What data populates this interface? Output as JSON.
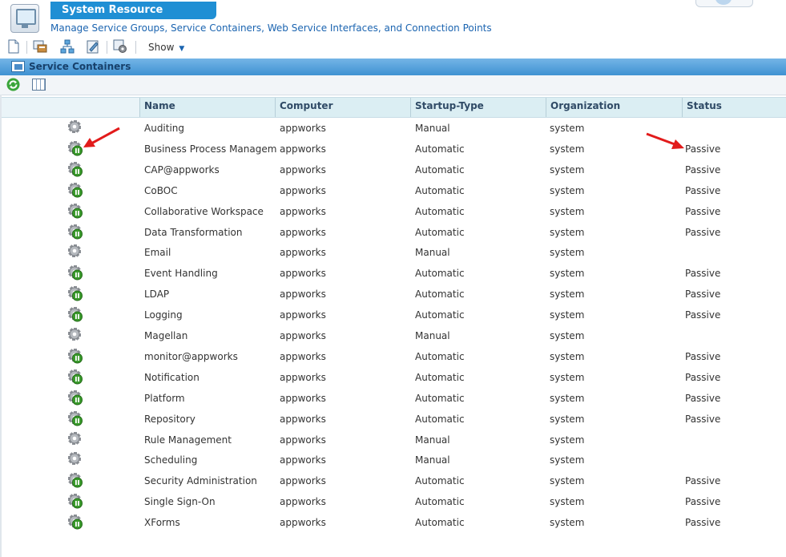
{
  "header": {
    "title": "System Resource Manager",
    "subtitle": "Manage Service Groups, Service Containers, Web Service Interfaces, and Connection Points"
  },
  "toolbar": {
    "icons": [
      "new-document-icon",
      "service-group-icon",
      "hierarchy-icon",
      "edit-icon",
      "configure-icon"
    ],
    "show_label": "Show"
  },
  "panel": {
    "title": "Service Containers",
    "refresh_icon": "refresh-icon",
    "columns_icon": "columns-icon"
  },
  "table": {
    "columns": [
      "Name",
      "Computer",
      "Startup-Type",
      "Organization",
      "Status"
    ],
    "rows": [
      {
        "name": "Auditing",
        "computer": "appworks",
        "startup": "Manual",
        "org": "system",
        "status": "",
        "icon": "gear-stopped-icon"
      },
      {
        "name": "Business Process Manageme",
        "computer": "appworks",
        "startup": "Automatic",
        "org": "system",
        "status": "Passive",
        "icon": "gear-running-icon"
      },
      {
        "name": "CAP@appworks",
        "computer": "appworks",
        "startup": "Automatic",
        "org": "system",
        "status": "Passive",
        "icon": "gear-running-icon"
      },
      {
        "name": "CoBOC",
        "computer": "appworks",
        "startup": "Automatic",
        "org": "system",
        "status": "Passive",
        "icon": "gear-running-icon"
      },
      {
        "name": "Collaborative Workspace",
        "computer": "appworks",
        "startup": "Automatic",
        "org": "system",
        "status": "Passive",
        "icon": "gear-running-icon"
      },
      {
        "name": "Data Transformation",
        "computer": "appworks",
        "startup": "Automatic",
        "org": "system",
        "status": "Passive",
        "icon": "gear-running-icon"
      },
      {
        "name": "Email",
        "computer": "appworks",
        "startup": "Manual",
        "org": "system",
        "status": "",
        "icon": "gear-stopped-icon"
      },
      {
        "name": "Event Handling",
        "computer": "appworks",
        "startup": "Automatic",
        "org": "system",
        "status": "Passive",
        "icon": "gear-running-icon"
      },
      {
        "name": "LDAP",
        "computer": "appworks",
        "startup": "Automatic",
        "org": "system",
        "status": "Passive",
        "icon": "gear-running-icon"
      },
      {
        "name": "Logging",
        "computer": "appworks",
        "startup": "Automatic",
        "org": "system",
        "status": "Passive",
        "icon": "gear-running-icon"
      },
      {
        "name": "Magellan",
        "computer": "appworks",
        "startup": "Manual",
        "org": "system",
        "status": "",
        "icon": "gear-stopped-icon"
      },
      {
        "name": "monitor@appworks",
        "computer": "appworks",
        "startup": "Automatic",
        "org": "system",
        "status": "Passive",
        "icon": "gear-running-icon"
      },
      {
        "name": "Notification",
        "computer": "appworks",
        "startup": "Automatic",
        "org": "system",
        "status": "Passive",
        "icon": "gear-running-icon"
      },
      {
        "name": "Platform",
        "computer": "appworks",
        "startup": "Automatic",
        "org": "system",
        "status": "Passive",
        "icon": "gear-running-icon"
      },
      {
        "name": "Repository",
        "computer": "appworks",
        "startup": "Automatic",
        "org": "system",
        "status": "Passive",
        "icon": "gear-running-icon"
      },
      {
        "name": "Rule Management",
        "computer": "appworks",
        "startup": "Manual",
        "org": "system",
        "status": "",
        "icon": "gear-stopped-icon"
      },
      {
        "name": "Scheduling",
        "computer": "appworks",
        "startup": "Manual",
        "org": "system",
        "status": "",
        "icon": "gear-stopped-icon"
      },
      {
        "name": "Security Administration",
        "computer": "appworks",
        "startup": "Automatic",
        "org": "system",
        "status": "Passive",
        "icon": "gear-running-icon"
      },
      {
        "name": "Single Sign-On",
        "computer": "appworks",
        "startup": "Automatic",
        "org": "system",
        "status": "Passive",
        "icon": "gear-running-icon"
      },
      {
        "name": "XForms",
        "computer": "appworks",
        "startup": "Automatic",
        "org": "system",
        "status": "Passive",
        "icon": "gear-running-icon"
      }
    ]
  },
  "annotations": {
    "arrow_color": "#e21b1b",
    "arrows": [
      "red-arrow-icon",
      "red-arrow-icon"
    ]
  },
  "colors": {
    "title_bar": "#1f8fd4",
    "panel_bar": "#4a9ad8",
    "running": "#3a9a2c",
    "stopped": "#9a9a9a"
  }
}
